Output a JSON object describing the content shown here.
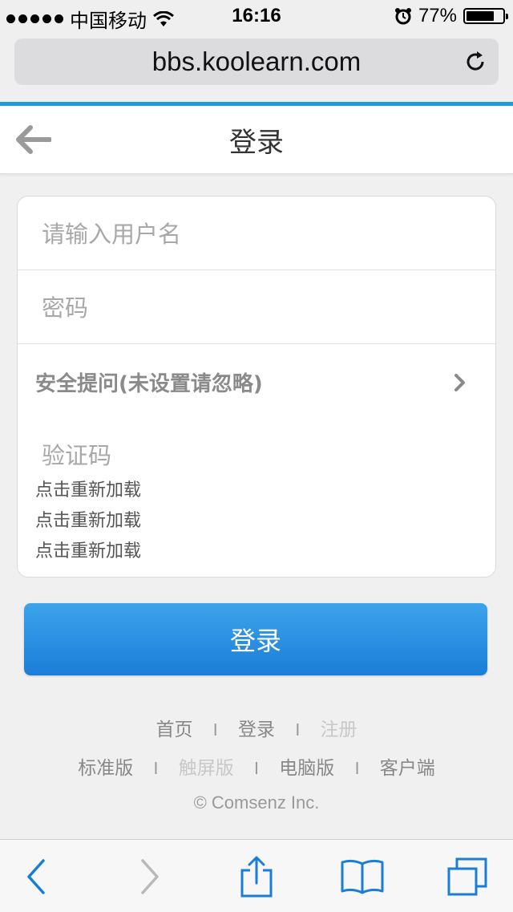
{
  "status_bar": {
    "carrier": "中国移动",
    "time": "16:16",
    "battery": "77%",
    "battery_level": 0.77,
    "icons": [
      "signal-dots-icon",
      "wifi-icon",
      "alarm-icon",
      "battery-icon"
    ]
  },
  "browser": {
    "url": "bbs.koolearn.com",
    "reload_icon": "reload-icon"
  },
  "header": {
    "title": "登录",
    "back_icon": "back-arrow-icon"
  },
  "form": {
    "username_placeholder": "请输入用户名",
    "password_placeholder": "密码",
    "security_question": "安全提问(未设置请忽略)",
    "captcha_placeholder": "验证码",
    "reload_lines": [
      "点击重新加载",
      "点击重新加载",
      "点击重新加载"
    ]
  },
  "login_button": "登录",
  "footer": {
    "row1": [
      "首页",
      "登录",
      "注册"
    ],
    "row2": [
      "标准版",
      "触屏版",
      "电脑版",
      "客户端"
    ],
    "separator": "I",
    "copyright": "© Comsenz Inc."
  },
  "toolbar": {
    "icons": [
      "back-icon",
      "forward-icon",
      "share-icon",
      "bookmarks-icon",
      "tabs-icon"
    ]
  },
  "colors": {
    "accent": "#1f9bd7",
    "button_top": "#3da3ea",
    "button_bottom": "#1a7ed9",
    "toolbar_icon": "#1a7ed9"
  }
}
